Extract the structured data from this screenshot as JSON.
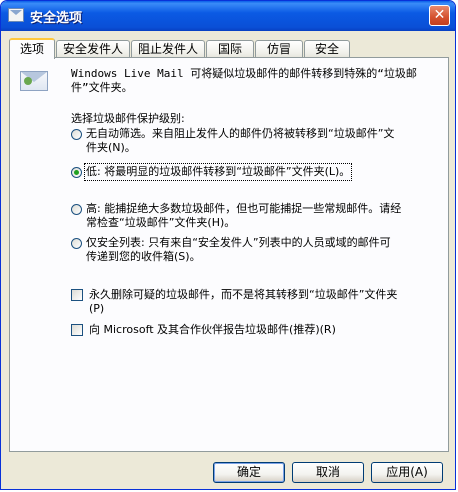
{
  "window": {
    "title": "安全选项",
    "close_glyph": "✕"
  },
  "tabs": [
    {
      "label": "选项",
      "active": true
    },
    {
      "label": "安全发件人"
    },
    {
      "label": "阻止发件人"
    },
    {
      "label": "国际"
    },
    {
      "label": "仿冒"
    },
    {
      "label": "安全"
    }
  ],
  "intro": {
    "line1": "Windows Live Mail 可将疑似垃圾邮件的邮件转移到特殊的“垃圾邮",
    "line2": "件”文件夹。"
  },
  "protection": {
    "heading": "选择垃圾邮件保护级别:",
    "options": [
      {
        "line1": "无自动筛选。来自阻止发件人的邮件仍将被转移到“垃圾邮件”文",
        "line2": "件夹(N)。",
        "checked": false
      },
      {
        "line1": "低: 将最明显的垃圾邮件转移到“垃圾邮件”文件夹(L)。",
        "line2": "",
        "checked": true
      },
      {
        "line1": "高: 能捕捉绝大多数垃圾邮件，但也可能捕捉一些常规邮件。请经",
        "line2": "常检查“垃圾邮件”文件夹(H)。",
        "checked": false
      },
      {
        "line1": "仅安全列表: 只有来自“安全发件人”列表中的人员或域的邮件可",
        "line2": "传递到您的收件箱(S)。",
        "checked": false
      }
    ]
  },
  "checkboxes": [
    {
      "line1": "永久删除可疑的垃圾邮件，而不是将其转移到“垃圾邮件”文件夹",
      "line2": "(P)",
      "checked": false
    },
    {
      "line1": "向 Microsoft 及其合作伙伴报告垃圾邮件(推荐)(R)",
      "line2": "",
      "checked": false
    }
  ],
  "buttons": {
    "ok": "确定",
    "cancel": "取消",
    "apply": "应用(A)"
  },
  "icons": {
    "title_icon": "mail-envelope-icon",
    "panel_icon": "junk-mail-envelope-icon",
    "close_icon": "close-icon"
  }
}
